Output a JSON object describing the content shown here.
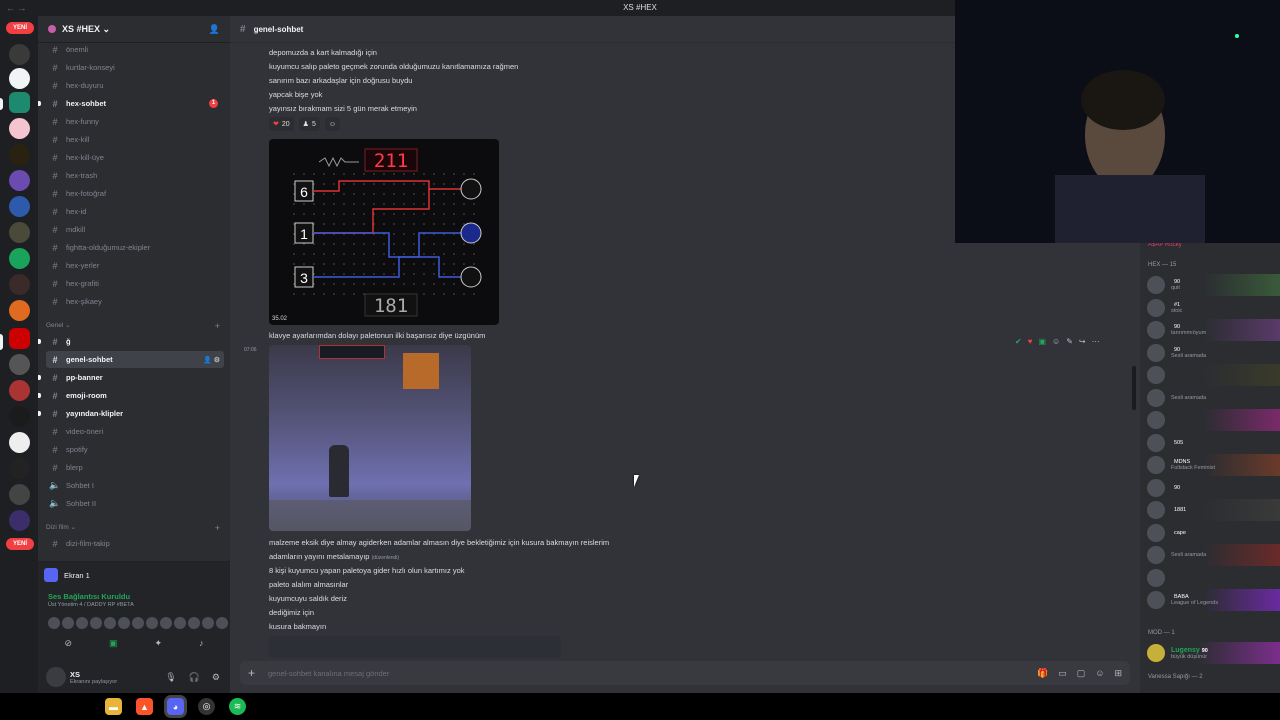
{
  "window": {
    "title": "XS #HEX",
    "nav": "← →"
  },
  "servers": {
    "new_label_top": "YENİ",
    "new_label_bottom": "YENİ"
  },
  "guild": {
    "name": "XS #HEX ⌄"
  },
  "channels": [
    {
      "name": "önemli",
      "state": "muted"
    },
    {
      "name": "kurtlar-konseyi",
      "state": "muted"
    },
    {
      "name": "hex-duyuru",
      "state": "muted"
    },
    {
      "name": "hex-sohbet",
      "state": "unread",
      "mention": "1"
    },
    {
      "name": "hex-funny",
      "state": "muted"
    },
    {
      "name": "hex-kill",
      "state": "muted"
    },
    {
      "name": "hex-kill-üye",
      "state": "muted"
    },
    {
      "name": "hex-trash",
      "state": "muted"
    },
    {
      "name": "hex-fotoğraf",
      "state": "muted"
    },
    {
      "name": "hex-id",
      "state": "muted"
    },
    {
      "name": "mdkill",
      "state": "muted"
    },
    {
      "name": "fightta-olduğumuz-ekipler",
      "state": "muted"
    },
    {
      "name": "hex-yerler",
      "state": "muted"
    },
    {
      "name": "hex-grafiti",
      "state": "muted"
    },
    {
      "name": "hex-şikaey",
      "state": "muted"
    }
  ],
  "category_genel": "Genel ⌄",
  "genel_channels": [
    {
      "name": "ğ",
      "state": "unread"
    },
    {
      "name": "genel-sohbet",
      "state": "active"
    },
    {
      "name": "pp-banner",
      "state": "unread"
    },
    {
      "name": "emoji-room",
      "state": "unread"
    },
    {
      "name": "yayından-klipler",
      "state": "unread"
    },
    {
      "name": "video-öneri",
      "state": "muted"
    },
    {
      "name": "spotify",
      "state": "muted"
    },
    {
      "name": "blerp",
      "state": "muted"
    },
    {
      "name": "Sohbet I",
      "state": "voice"
    },
    {
      "name": "Sohbet II",
      "state": "voice"
    }
  ],
  "category_dizi": "Dizi film ⌄",
  "dizi_channels": [
    {
      "name": "dizi-film-takip",
      "state": "muted"
    }
  ],
  "voice_panel": {
    "stream_label": "Ekran 1",
    "status": "Ses Bağlantısı Kuruldu",
    "sub": "Üst Yönetim 4 / DADDY RP #BETA"
  },
  "user": {
    "name": "XS",
    "status": "Ekranını paylaşıyor"
  },
  "channel_header": {
    "name": "genel-sohbet"
  },
  "messages": [
    "depomuzda a kart kalmadığı için",
    "kuyumcu salıp paleto geçmek zorunda olduğumuzu kanıtlamamıza rağmen",
    "sanırım bazı arkadaşlar için doğrusu buydu",
    "yapcak bişe yok",
    "yayınsız bırakmam sizi 5 gün merak etmeyin"
  ],
  "reactions": [
    {
      "emoji": "❤",
      "count": "20"
    },
    {
      "emoji": "♟",
      "count": "5"
    },
    {
      "emoji": "☺",
      "count": ""
    }
  ],
  "image1_timestamp": "35.02",
  "minigame": {
    "target": "211",
    "current": "181",
    "left_values": [
      "6",
      "1",
      "3"
    ]
  },
  "message_after_image": "klavye ayarlarımdan dolayı paletonun ilki başarısız diye üzgünüm",
  "time_stamp_2": "07:06",
  "messages2": [
    "malzeme eksik diye almay agiderken adamlar almasın diye bekletiğimiz için kusura bakmayın reislerim",
    "adamların yayını metalamayıp",
    "8 kişi kuyumcu yapan paletoya gider hızlı olun kartımız yok",
    "paleto alalım almasınlar",
    "kuyumcuyu saldık deriz",
    "dediğimiz için",
    "kusura bakmayın"
  ],
  "edited_label": "(düzenlendi)",
  "composer": {
    "placeholder": "genel-sohbet kanalına mesaj gönder"
  },
  "members": {
    "group_hex": "HEX — 15",
    "hex_members": [
      {
        "name": "",
        "status": "quit",
        "badge": "90",
        "color": "#f23f43"
      },
      {
        "name": "",
        "status": "stoic",
        "badge": "#1",
        "color": "#f23f43"
      },
      {
        "name": "",
        "status": "tanrımmıöyum",
        "badge": "90",
        "color": "#f23f43"
      },
      {
        "name": "",
        "status": "Sesli aramada",
        "badge": "90",
        "color": "#f23f43"
      },
      {
        "name": "",
        "status": "",
        "badge": "",
        "color": "#f23f43"
      },
      {
        "name": "",
        "status": "Sesli aramada",
        "badge": "",
        "color": "#f23f43"
      },
      {
        "name": "",
        "status": "",
        "badge": "",
        "color": "#f23f43"
      },
      {
        "name": "",
        "status": "",
        "badge": "505",
        "color": "#f23f43"
      },
      {
        "name": "",
        "status": "Fullstack Feminist",
        "badge": "MDNS",
        "color": "#f23f43"
      },
      {
        "name": "",
        "status": "",
        "badge": "90",
        "color": "#f23f43"
      },
      {
        "name": "",
        "status": "",
        "badge": "1881",
        "color": "#f23f43"
      },
      {
        "name": "",
        "status": "",
        "badge": "cape",
        "color": "#f23f43"
      },
      {
        "name": "",
        "status": "Sesli aramada",
        "badge": "",
        "color": "#f23f43"
      },
      {
        "name": "",
        "status": "",
        "badge": "",
        "color": "#f23f43"
      },
      {
        "name": "",
        "status": "League of Legends",
        "badge": "BABA",
        "color": "#f23f43"
      }
    ],
    "group_mod": "MOD — 1",
    "mod_member": {
      "name": "Lugensy",
      "status": "büyük düşünür",
      "badge": "90"
    },
    "group_vanessa": "Vanessa Sapığı — 2",
    "top_partial": "A$AP Rocky"
  }
}
